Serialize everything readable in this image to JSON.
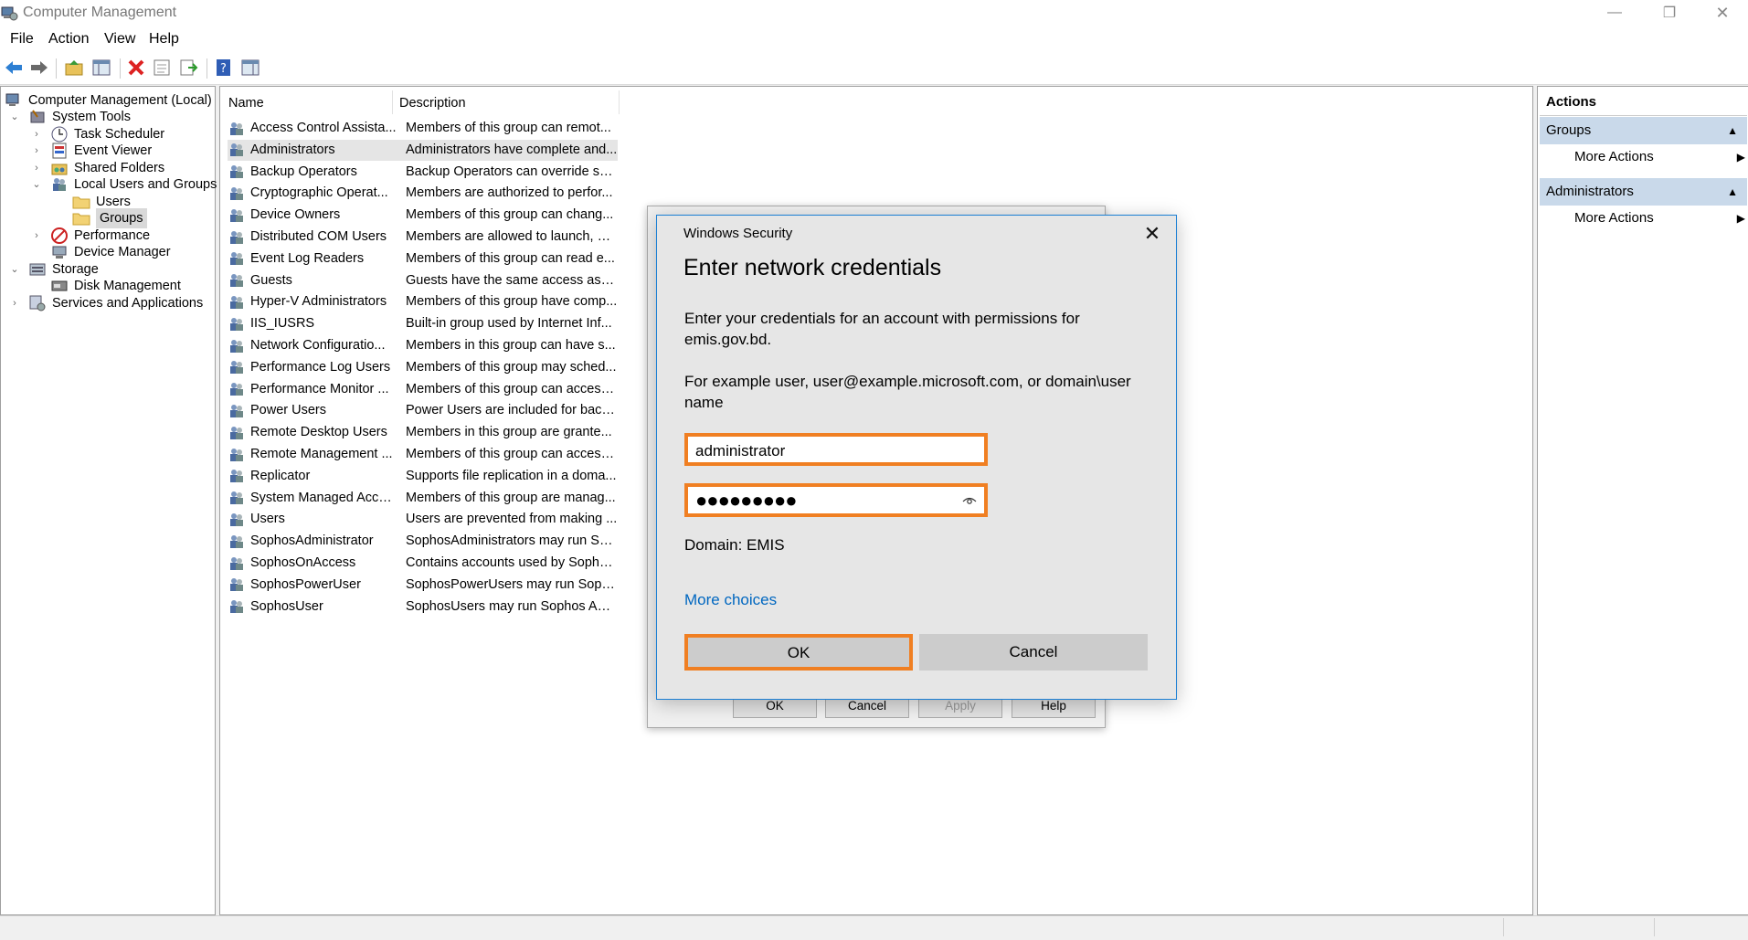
{
  "window": {
    "title": "Computer Management",
    "controls": [
      "minimize",
      "restore",
      "close"
    ]
  },
  "menu": [
    "File",
    "Action",
    "View",
    "Help"
  ],
  "toolbar": {
    "icons": [
      "back-icon",
      "forward-icon",
      "up-folder-icon",
      "show-hide-tree-icon",
      "delete-icon",
      "properties-icon",
      "export-list-icon",
      "help-icon",
      "show-hide-action-pane-icon"
    ]
  },
  "tree": {
    "root": "Computer Management (Local)",
    "items": [
      {
        "label": "System Tools",
        "chev": "⌄"
      },
      {
        "label": "Task Scheduler",
        "chev": "›"
      },
      {
        "label": "Event Viewer",
        "chev": "›"
      },
      {
        "label": "Shared Folders",
        "chev": "›"
      },
      {
        "label": "Local Users and Groups",
        "chev": "⌄"
      },
      {
        "label": "Users",
        "chev": ""
      },
      {
        "label": "Groups",
        "chev": ""
      },
      {
        "label": "Performance",
        "chev": "›"
      },
      {
        "label": "Device Manager",
        "chev": ""
      },
      {
        "label": "Storage",
        "chev": "⌄"
      },
      {
        "label": "Disk Management",
        "chev": ""
      },
      {
        "label": "Services and Applications",
        "chev": "›"
      }
    ]
  },
  "list": {
    "columns": {
      "name": "Name",
      "description": "Description"
    },
    "rows": [
      {
        "name": "Access Control Assista...",
        "desc": "Members of this group can remot..."
      },
      {
        "name": "Administrators",
        "desc": "Administrators have complete and..."
      },
      {
        "name": "Backup Operators",
        "desc": "Backup Operators can override sec..."
      },
      {
        "name": "Cryptographic Operat...",
        "desc": "Members are authorized to perfor..."
      },
      {
        "name": "Device Owners",
        "desc": "Members of this group can chang..."
      },
      {
        "name": "Distributed COM Users",
        "desc": "Members are allowed to launch, ac..."
      },
      {
        "name": "Event Log Readers",
        "desc": "Members of this group can read e..."
      },
      {
        "name": "Guests",
        "desc": "Guests have the same access as m..."
      },
      {
        "name": "Hyper-V Administrators",
        "desc": "Members of this group have comp..."
      },
      {
        "name": "IIS_IUSRS",
        "desc": "Built-in group used by Internet Inf..."
      },
      {
        "name": "Network Configuratio...",
        "desc": "Members in this group can have s..."
      },
      {
        "name": "Performance Log Users",
        "desc": "Members of this group may sched..."
      },
      {
        "name": "Performance Monitor ...",
        "desc": "Members of this group can access ..."
      },
      {
        "name": "Power Users",
        "desc": "Power Users are included for back..."
      },
      {
        "name": "Remote Desktop Users",
        "desc": "Members in this group are grante..."
      },
      {
        "name": "Remote Management ...",
        "desc": "Members of this group can access ..."
      },
      {
        "name": "Replicator",
        "desc": "Supports file replication in a doma..."
      },
      {
        "name": "System Managed Acco...",
        "desc": "Members of this group are manag..."
      },
      {
        "name": "Users",
        "desc": "Users are prevented from making ..."
      },
      {
        "name": "SophosAdministrator",
        "desc": "SophosAdministrators may run So..."
      },
      {
        "name": "SophosOnAccess",
        "desc": "Contains accounts used by Sopho..."
      },
      {
        "name": "SophosPowerUser",
        "desc": "SophosPowerUsers may run Soph..."
      },
      {
        "name": "SophosUser",
        "desc": "SophosUsers may run Sophos Anti..."
      }
    ]
  },
  "actions": {
    "title": "Actions",
    "sections": [
      {
        "header": "Groups",
        "item": "More Actions"
      },
      {
        "header": "Administrators",
        "item": "More Actions"
      }
    ]
  },
  "properties_dialog": {
    "buttons": [
      "OK",
      "Cancel",
      "Apply",
      "Help"
    ]
  },
  "credential_dialog": {
    "app": "Windows Security",
    "heading": "Enter network credentials",
    "message1": "Enter your credentials for an account with permissions for emis.gov.bd.",
    "message2": "For example user, user@example.microsoft.com, or domain\\user name",
    "username": "administrator",
    "password_mask": "●●●●●●●●●",
    "domain": "Domain: EMIS",
    "more_choices": "More choices",
    "ok": "OK",
    "cancel": "Cancel",
    "highlight_color": "#f07f22",
    "link_color": "#0067c0"
  }
}
